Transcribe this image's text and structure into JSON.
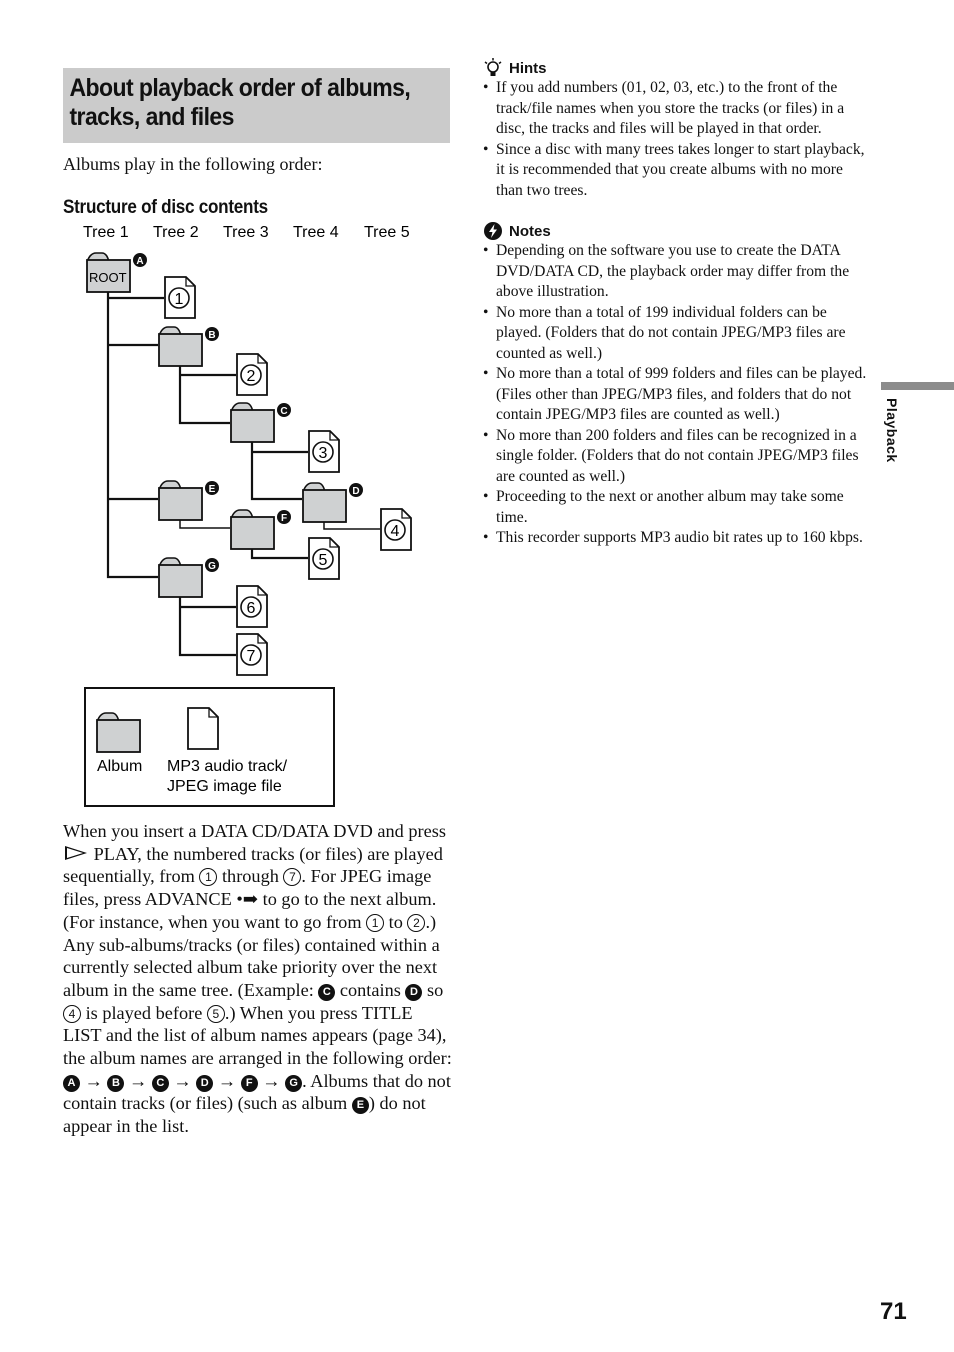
{
  "title": "About playback order of albums, tracks, and files",
  "title_lines": [
    "About playback order of albums,",
    "tracks, and files"
  ],
  "intro": "Albums play in the following order:",
  "structure_heading": "Structure of disc contents",
  "diagram": {
    "trees": [
      "Tree 1",
      "Tree 2",
      "Tree 3",
      "Tree 4",
      "Tree 5"
    ],
    "root_label": "ROOT",
    "albums": [
      {
        "id": "A",
        "label": "A",
        "tree": 1,
        "is_root": true
      },
      {
        "id": "B",
        "label": "B",
        "tree": 2,
        "parent": "A"
      },
      {
        "id": "C",
        "label": "C",
        "tree": 3,
        "parent": "B"
      },
      {
        "id": "D",
        "label": "D",
        "tree": 4,
        "parent": "C"
      },
      {
        "id": "E",
        "label": "E",
        "tree": 2,
        "parent": "A"
      },
      {
        "id": "F",
        "label": "F",
        "tree": 3,
        "parent": "E"
      },
      {
        "id": "G",
        "label": "G",
        "tree": 2,
        "parent": "A"
      }
    ],
    "files": [
      {
        "num": "1",
        "parent": "A"
      },
      {
        "num": "2",
        "parent": "B"
      },
      {
        "num": "3",
        "parent": "C"
      },
      {
        "num": "4",
        "parent": "D"
      },
      {
        "num": "5",
        "parent": "F"
      },
      {
        "num": "6",
        "parent": "G"
      },
      {
        "num": "7",
        "parent": "G"
      }
    ],
    "legend": {
      "album_label": "Album",
      "file_label_line1": "MP3 audio track/",
      "file_label_line2": "JPEG image file"
    }
  },
  "body": {
    "p1": "When you insert a DATA CD/DATA DVD and press ",
    "p2": " PLAY, the numbered tracks (or files) are played sequentially, from ",
    "c1": "1",
    "p3": " through ",
    "c7": "7",
    "p4": ". For JPEG image files, press ADVANCE ",
    "advance_symbol": "•➡",
    "p5": " to go to the next album. (For instance, when you want to go from ",
    "p6": " to ",
    "c2": "2",
    "p7": ".) Any sub-albums/tracks (or files) contained within a currently selected album take priority over the next album in the same tree. (Example: ",
    "bC": "C",
    "p8": " contains ",
    "bD": "D",
    "p9": " so ",
    "c4": "4",
    "p10": " is played before ",
    "c5": "5",
    "p11": ".) When you press TITLE LIST and the list of album names appears (page 34), the album names are arranged in the following order: ",
    "order": [
      "A",
      "B",
      "C",
      "D",
      "F",
      "G"
    ],
    "arrow": "→",
    "p12": ". Albums that do not contain tracks (or files) (such as album ",
    "bE": "E",
    "p13": ") do not appear in the list."
  },
  "hints": {
    "heading": "Hints",
    "items": [
      "If you add numbers (01, 02, 03, etc.) to the front of the track/file names when you store the tracks (or files) in a disc, the tracks and files will be played in that order.",
      "Since a disc with many trees takes longer to start playback, it is recommended that you create albums with no more than two trees."
    ]
  },
  "notes": {
    "heading": "Notes",
    "items": [
      "Depending on the software you use to create the DATA DVD/DATA CD, the playback order may differ from the above illustration.",
      "No more than a total of 199 individual folders can be played. (Folders that do not contain JPEG/MP3 files are counted as well.)",
      "No more than a total of 999 folders and files can be played. (Files other than JPEG/MP3 files, and folders that do not contain JPEG/MP3 files are counted as well.)",
      "No more than 200 folders and files can be recognized in a single folder. (Folders that do not contain JPEG/MP3 files are counted as well.)",
      "Proceeding to the next or another album may take some time.",
      "This recorder supports MP3 audio bit rates up to 160 kbps."
    ]
  },
  "side_tab": "Playback",
  "page_number": "71",
  "colors": {
    "title_bg": "#cbcbcb",
    "folder_fill": "#cfd1d2",
    "side_tab_bar": "#8c8c8c",
    "ink": "#111111"
  }
}
